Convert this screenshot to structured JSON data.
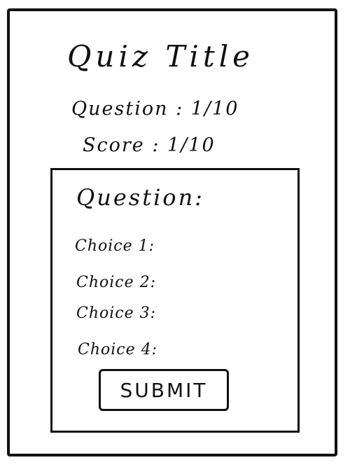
{
  "header": {
    "title": "Quiz Title",
    "question_progress": "Question : 1/10",
    "score": "Score : 1/10"
  },
  "question_card": {
    "question_label": "Question:",
    "choices": [
      "Choice 1:",
      "Choice 2:",
      "Choice 3:",
      "Choice 4:"
    ],
    "submit_label": "SUBMIT"
  }
}
